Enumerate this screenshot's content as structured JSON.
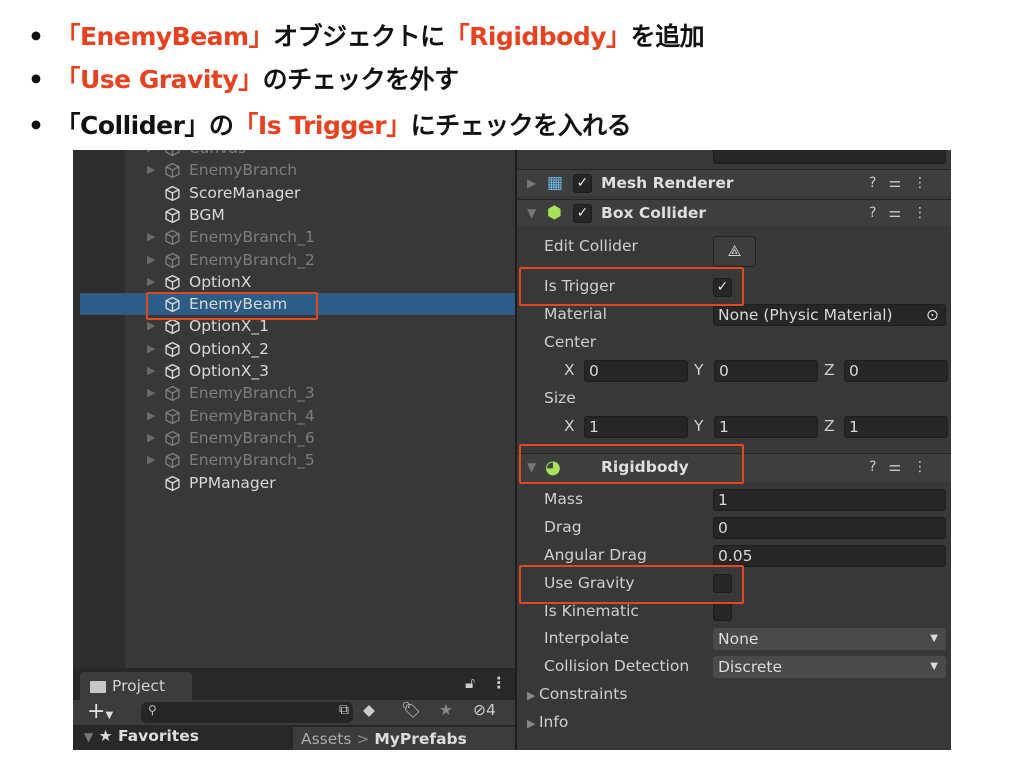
{
  "instructions": [
    {
      "parts": [
        {
          "text": "「EnemyBeam」",
          "red": true
        },
        {
          "text": "オブジェクトに",
          "red": false
        },
        {
          "text": "「Rigidbody」",
          "red": true
        },
        {
          "text": "を追加",
          "red": false
        }
      ]
    },
    {
      "parts": [
        {
          "text": "「Use Gravity」",
          "red": true
        },
        {
          "text": "のチェックを外す",
          "red": false
        }
      ]
    },
    {
      "parts": [
        {
          "text": "「Collider」の",
          "red": false
        },
        {
          "text": "「Is Trigger」",
          "red": true
        },
        {
          "text": "にチェックを入れる",
          "red": false
        }
      ]
    }
  ],
  "bullet_char": "•",
  "hierarchy": {
    "items": [
      {
        "name": "Canvas",
        "dim": true,
        "arrow": true
      },
      {
        "name": "EnemyBranch",
        "dim": true,
        "arrow": true
      },
      {
        "name": "ScoreManager",
        "dim": false,
        "arrow": false
      },
      {
        "name": "BGM",
        "dim": false,
        "arrow": false
      },
      {
        "name": "EnemyBranch_1",
        "dim": true,
        "arrow": true
      },
      {
        "name": "EnemyBranch_2",
        "dim": true,
        "arrow": true
      },
      {
        "name": "OptionX",
        "dim": false,
        "arrow": true
      },
      {
        "name": "EnemyBeam",
        "dim": false,
        "arrow": false,
        "selected": true
      },
      {
        "name": "OptionX_1",
        "dim": false,
        "arrow": true
      },
      {
        "name": "OptionX_2",
        "dim": false,
        "arrow": true
      },
      {
        "name": "OptionX_3",
        "dim": false,
        "arrow": true
      },
      {
        "name": "EnemyBranch_3",
        "dim": true,
        "arrow": true
      },
      {
        "name": "EnemyBranch_4",
        "dim": true,
        "arrow": true
      },
      {
        "name": "EnemyBranch_6",
        "dim": true,
        "arrow": true
      },
      {
        "name": "EnemyBranch_5",
        "dim": true,
        "arrow": true
      },
      {
        "name": "PPManager",
        "dim": false,
        "arrow": false
      }
    ]
  },
  "project": {
    "tab": "Project",
    "hidden_count": "4",
    "favorites": "Favorites",
    "breadcrumb": [
      "Assets",
      "MyPrefabs"
    ]
  },
  "inspector": {
    "mesh_renderer": {
      "title": "Mesh Renderer",
      "enabled": true
    },
    "box_collider": {
      "title": "Box Collider",
      "enabled": true,
      "edit_collider": "Edit Collider",
      "is_trigger": "Is Trigger",
      "is_trigger_checked": true,
      "material": "Material",
      "material_value": "None (Physic Material)",
      "center": "Center",
      "center_x": "0",
      "center_y": "0",
      "center_z": "0",
      "size": "Size",
      "size_x": "1",
      "size_y": "1",
      "size_z": "1",
      "x": "X",
      "y": "Y",
      "z": "Z"
    },
    "rigidbody": {
      "title": "Rigidbody",
      "mass": "Mass",
      "mass_value": "1",
      "drag": "Drag",
      "drag_value": "0",
      "angular_drag": "Angular Drag",
      "angular_drag_value": "0.05",
      "use_gravity": "Use Gravity",
      "use_gravity_checked": false,
      "is_kinematic": "Is Kinematic",
      "is_kinematic_checked": false,
      "interpolate": "Interpolate",
      "interpolate_value": "None",
      "collision_detection": "Collision Detection",
      "collision_detection_value": "Discrete",
      "constraints": "Constraints",
      "info": "Info"
    }
  },
  "colors": {
    "highlight": "#e0481f",
    "selection": "#2c5d87",
    "panel": "#383838"
  }
}
